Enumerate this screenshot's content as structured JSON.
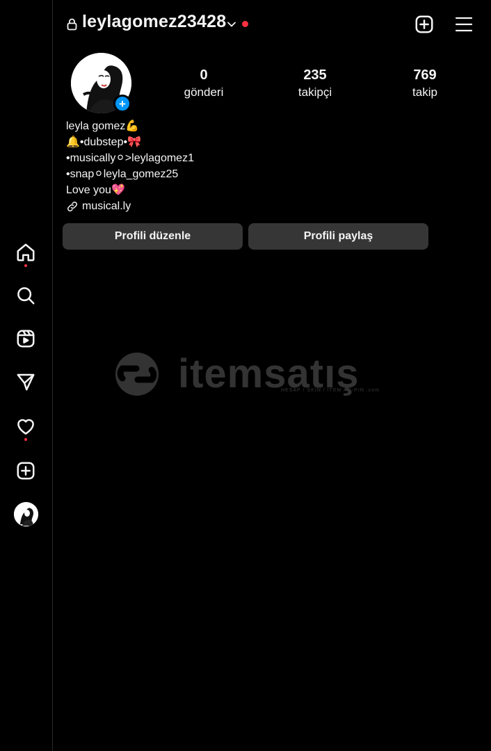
{
  "header": {
    "username": "leylagomez23428"
  },
  "stats": [
    {
      "value": "0",
      "label": "gönderi"
    },
    {
      "value": "235",
      "label": "takipçi"
    },
    {
      "value": "769",
      "label": "takip"
    }
  ],
  "bio": {
    "lines": [
      "leyla gomez💪",
      "🔔•dubstep•🎀",
      "•musically⚪>leylagomez1",
      "•snap⚪leyla_gomez25",
      "Love you💖"
    ],
    "link": "musical.ly"
  },
  "buttons": {
    "edit_profile": "Profili düzenle",
    "share_profile": "Profili paylaş"
  },
  "sidebar": {
    "items": [
      "home-icon",
      "search-icon",
      "reels-icon",
      "direct-icon",
      "heart-icon",
      "create-icon",
      "profile-avatar"
    ]
  },
  "watermark": {
    "text": "itemsatış",
    "subtext": "HESAP / SKIN / ITEM / E-PIN  .com"
  },
  "colors": {
    "background": "#000000",
    "button": "#363636",
    "accent_blue": "#0095f6",
    "notification_red": "#ff3040"
  }
}
